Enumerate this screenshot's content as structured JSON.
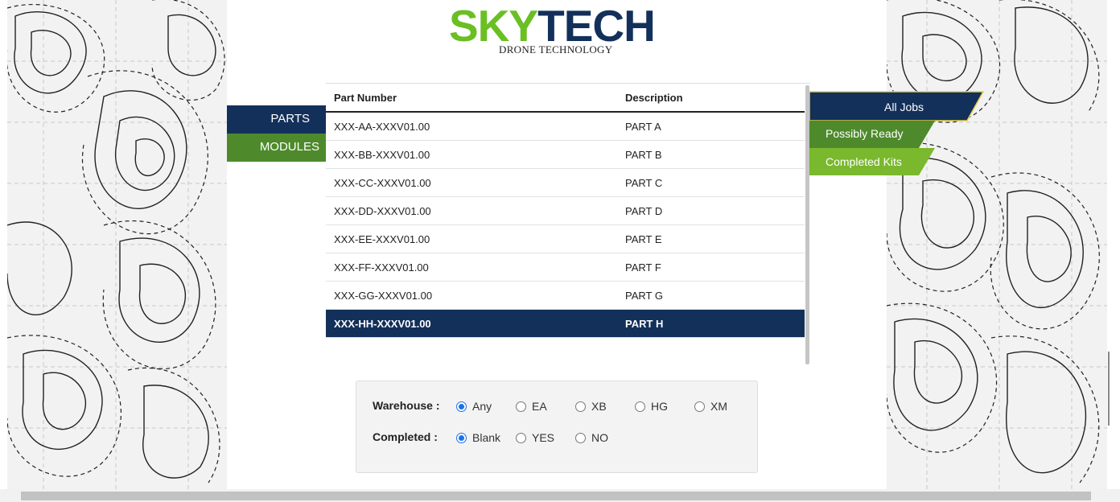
{
  "brand": {
    "word_part1": "SKY",
    "word_part2": "TECH",
    "tagline": "DRONE TECHNOLOGY",
    "color_sky": "#6abf23",
    "color_tech": "#13305a"
  },
  "left_nav": {
    "items": [
      {
        "label": "PARTS",
        "color": "#13305a"
      },
      {
        "label": "MODULES",
        "color": "#4e8a2c"
      }
    ]
  },
  "table": {
    "columns": [
      "Part Number",
      "Description"
    ],
    "rows": [
      {
        "part": "XXX-AA-XXXV01.00",
        "desc": "PART A"
      },
      {
        "part": "XXX-BB-XXXV01.00",
        "desc": "PART B"
      },
      {
        "part": "XXX-CC-XXXV01.00",
        "desc": "PART C"
      },
      {
        "part": "XXX-DD-XXXV01.00",
        "desc": "PART D"
      },
      {
        "part": "XXX-EE-XXXV01.00",
        "desc": "PART E"
      },
      {
        "part": "XXX-FF-XXXV01.00",
        "desc": "PART F"
      },
      {
        "part": "XXX-GG-XXXV01.00",
        "desc": "PART G"
      },
      {
        "part": "XXX-HH-XXXV01.00",
        "desc": "PART H",
        "selected": true
      }
    ]
  },
  "right_tabs": {
    "items": [
      {
        "label": "All Jobs",
        "color": "#13305a",
        "active": true
      },
      {
        "label": "Possibly Ready",
        "color": "#4e8a2c"
      },
      {
        "label": "Completed Kits",
        "color": "#7ab82e"
      }
    ]
  },
  "filters": {
    "warehouse": {
      "label": "Warehouse :",
      "options": [
        "Any",
        "EA",
        "XB",
        "HG",
        "XM"
      ],
      "selected": "Any"
    },
    "completed": {
      "label": "Completed :",
      "options": [
        "Blank",
        "YES",
        "NO"
      ],
      "selected": "Blank"
    }
  }
}
